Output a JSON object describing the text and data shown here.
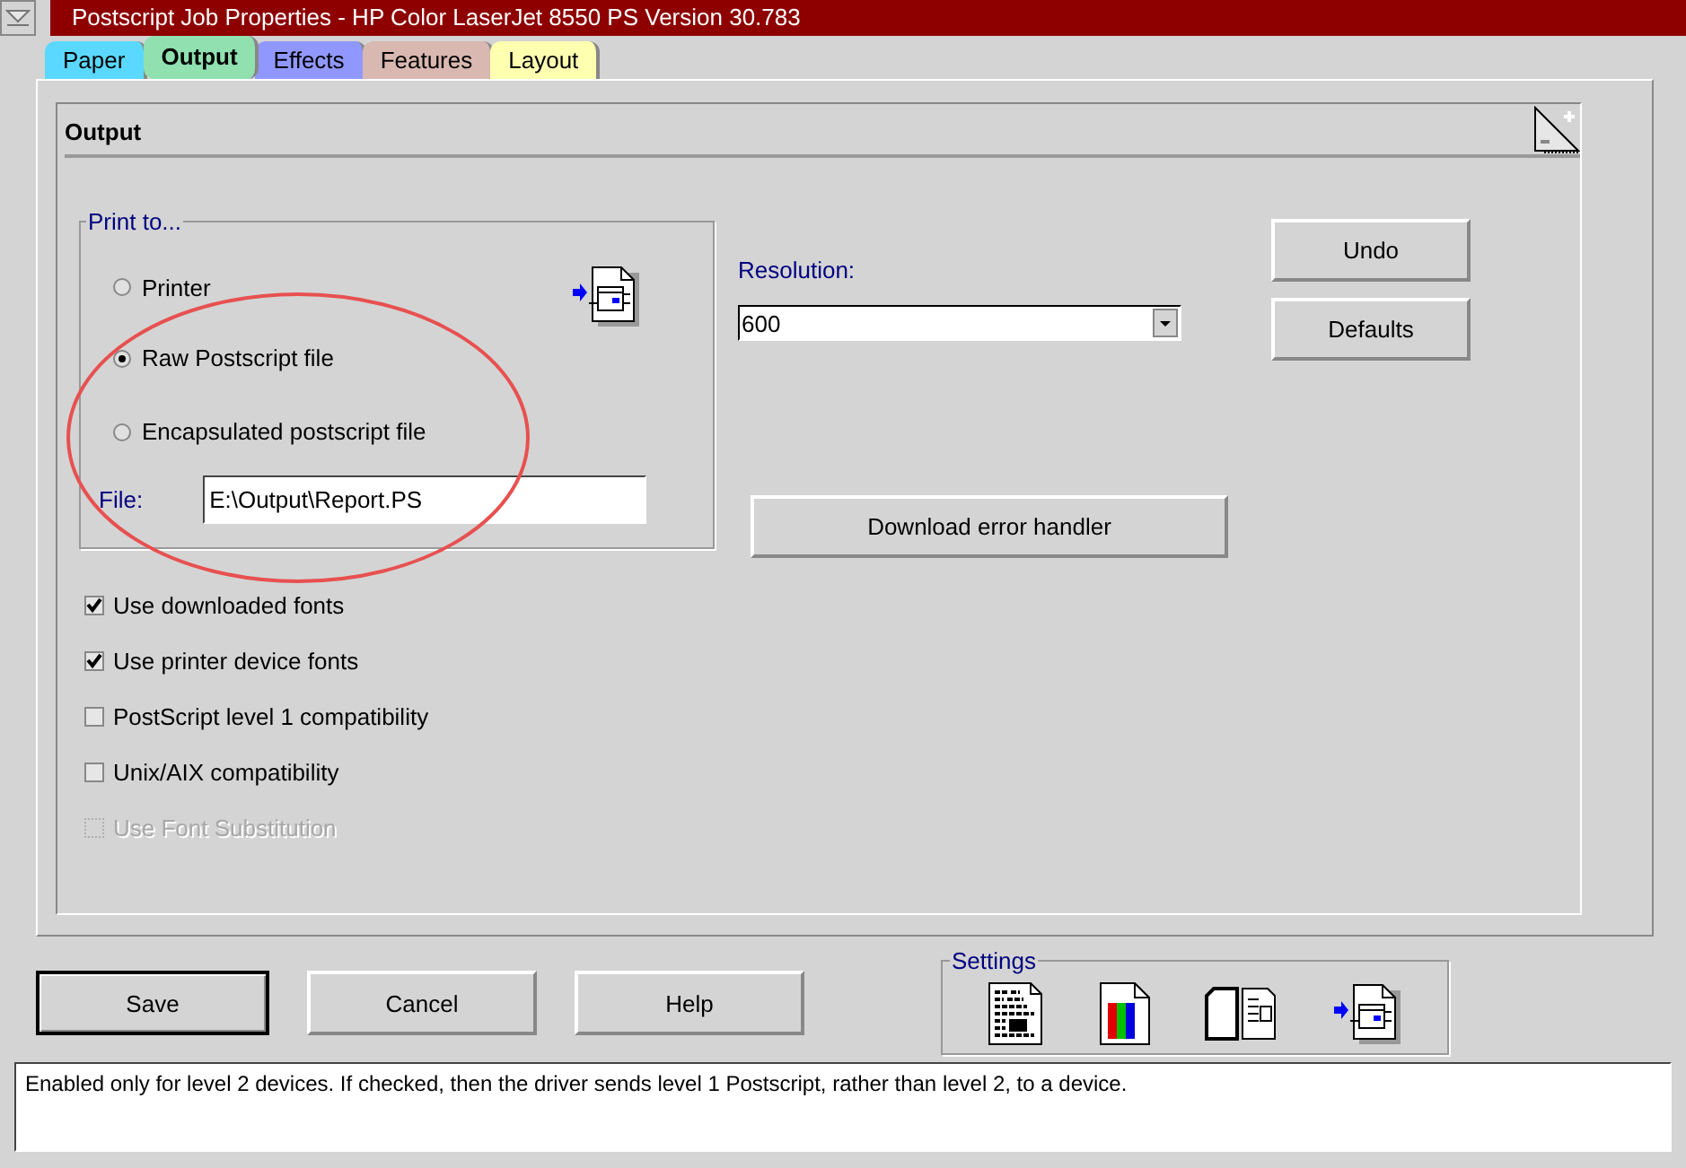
{
  "window": {
    "title": "Postscript Job Properties - HP Color LaserJet 8550 PS Version 30.783"
  },
  "tabs": [
    {
      "label": "Paper",
      "color": "#5ad8ff",
      "selected": false
    },
    {
      "label": "Output",
      "color": "#90e0b0",
      "selected": true
    },
    {
      "label": "Effects",
      "color": "#9098ff",
      "selected": false
    },
    {
      "label": "Features",
      "color": "#d8b8b0",
      "selected": false
    },
    {
      "label": "Layout",
      "color": "#ffffb0",
      "selected": false
    }
  ],
  "page": {
    "title": "Output"
  },
  "print_to": {
    "label": "Print to...",
    "options": [
      {
        "label": "Printer",
        "selected": false
      },
      {
        "label": "Raw Postscript file",
        "selected": true
      },
      {
        "label": "Encapsulated postscript file",
        "selected": false
      }
    ],
    "file": {
      "label": "File:",
      "value": "E:\\Output\\Report.PS"
    }
  },
  "resolution": {
    "label": "Resolution:",
    "value": "600"
  },
  "download_button": "Download error handler",
  "side_buttons": [
    "Undo",
    "Defaults"
  ],
  "options": [
    {
      "label": "Use downloaded fonts",
      "checked": true,
      "disabled": false
    },
    {
      "label": "Use printer device fonts",
      "checked": true,
      "disabled": false
    },
    {
      "label": "PostScript level 1 compatibility",
      "checked": false,
      "disabled": false
    },
    {
      "label": "Unix/AIX compatibility",
      "checked": false,
      "disabled": false
    },
    {
      "label": "Use Font Substitution",
      "checked": false,
      "disabled": true
    }
  ],
  "buttons": [
    {
      "label": "Save",
      "default": true
    },
    {
      "label": "Cancel",
      "default": false
    },
    {
      "label": "Help",
      "default": false
    }
  ],
  "settings": {
    "label": "Settings"
  },
  "status_text": "Enabled only for level 2 devices.  If checked, then the driver sends level 1 Postscript, rather than level 2, to a device."
}
